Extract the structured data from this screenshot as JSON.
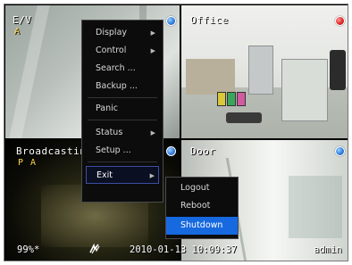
{
  "cameras": [
    {
      "label": "E/V",
      "sub": "A",
      "indicator": "blue"
    },
    {
      "label": "Office",
      "sub": "",
      "indicator": "red"
    },
    {
      "label": "Broadcastin",
      "sub": "P A",
      "indicator": "blue"
    },
    {
      "label": "Door",
      "sub": "",
      "indicator": "blue"
    }
  ],
  "status": {
    "disk": "99%*",
    "net_icon": "network-icon",
    "datetime": "2010-01-13 10:09:37",
    "user": "admin"
  },
  "main_menu": {
    "items": [
      {
        "label": "Display",
        "has_submenu": true
      },
      {
        "label": "Control",
        "has_submenu": true
      },
      {
        "label": "Search ...",
        "has_submenu": false
      },
      {
        "label": "Backup ...",
        "has_submenu": false
      },
      {
        "label": "Panic",
        "has_submenu": false
      },
      {
        "label": "Status",
        "has_submenu": true
      },
      {
        "label": "Setup ...",
        "has_submenu": false
      },
      {
        "label": "Exit",
        "has_submenu": true
      }
    ],
    "arrow": "▶"
  },
  "exit_submenu": {
    "items": [
      {
        "label": "Logout"
      },
      {
        "label": "Reboot"
      },
      {
        "label": "Shutdown"
      }
    ]
  },
  "colors": {
    "indicator_blue": "#2f7fe0",
    "indicator_red": "#e02828",
    "highlight": "#1769e0"
  }
}
